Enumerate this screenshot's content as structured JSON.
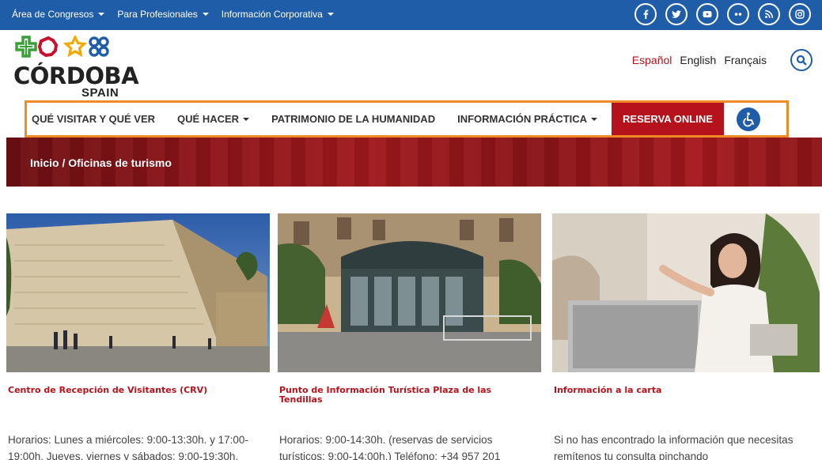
{
  "topbar": {
    "nav": [
      {
        "label": "Área de Congresos"
      },
      {
        "label": "Para Profesionales"
      },
      {
        "label": "Información Corporativa"
      }
    ],
    "social_icons": [
      "facebook-icon",
      "twitter-icon",
      "youtube-icon",
      "flickr-icon",
      "rss-icon",
      "instagram-icon"
    ],
    "color": "#1f5da8"
  },
  "logo": {
    "word": "CÓRDOBA",
    "sub": "SPAIN",
    "shape_colors": [
      "#3aa138",
      "#c8102e",
      "#f2a900",
      "#1f5da8"
    ]
  },
  "languages": [
    {
      "label": "Español",
      "active": true
    },
    {
      "label": "English",
      "active": false
    },
    {
      "label": "Français",
      "active": false
    }
  ],
  "main_nav": {
    "items": [
      {
        "label": "QUÉ VISITAR Y QUÉ VER",
        "dropdown": false
      },
      {
        "label": "QUÉ HACER",
        "dropdown": true
      },
      {
        "label": "PATRIMONIO DE LA HUMANIDAD",
        "dropdown": false
      },
      {
        "label": "INFORMACIÓN PRÁCTICA",
        "dropdown": true
      }
    ],
    "reserve_label": "RESERVA ONLINE",
    "accent": "#b5121b",
    "highlight_border": "#f08a24"
  },
  "breadcrumb": {
    "home": "Inicio",
    "separator": " / ",
    "current": "Oficinas de turismo"
  },
  "cards": [
    {
      "title": "Centro de Recepción de Visitantes (CRV)",
      "text": "Horarios: Lunes a miércoles: 9:00-13:30h. y 17:00-19:00h. Jueves, viernes y sábados: 9:00-19:30h."
    },
    {
      "title": "Punto de Información Turística Plaza de las Tendillas",
      "text": "Horarios: 9:00-14:30h. (reservas de servicios turísticos: 9:00-14:00h.) Teléfono: +34 957 201"
    },
    {
      "title": "Información a la carta",
      "text": "Si no has encontrado la información que necesitas remítenos tu consulta pinchando"
    }
  ]
}
